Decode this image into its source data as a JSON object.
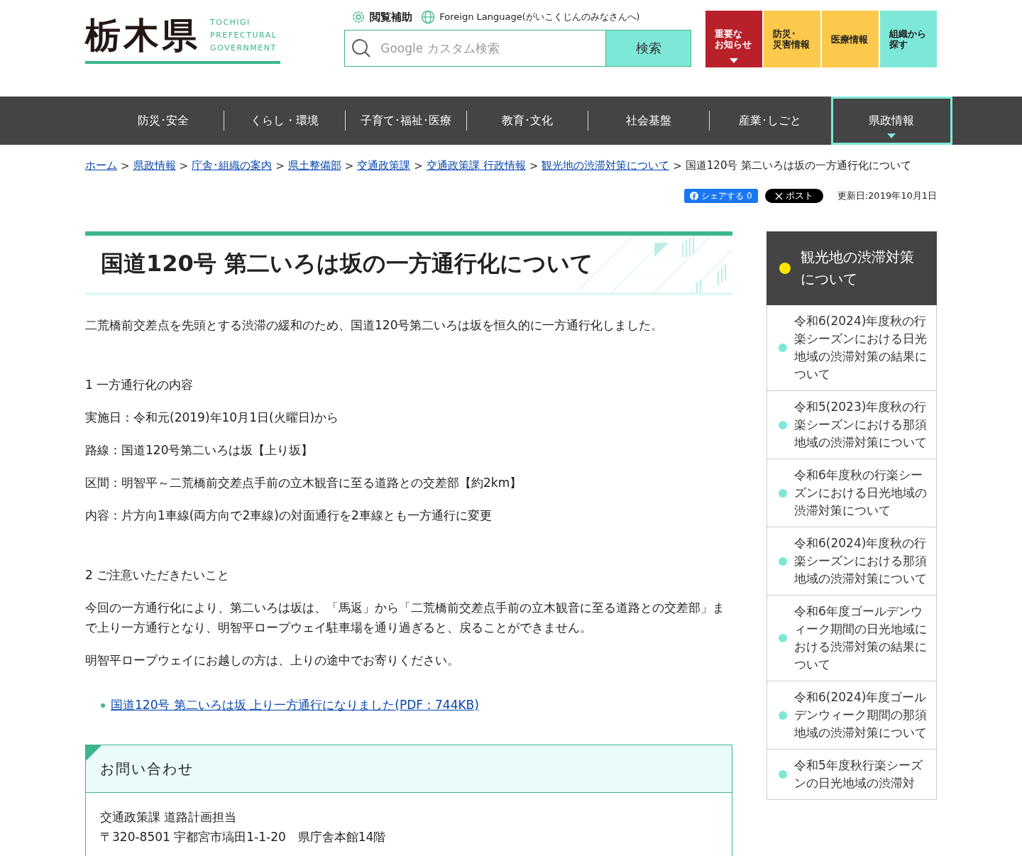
{
  "header": {
    "logo": {
      "kanji": "栃木県",
      "english": [
        "TOCHIGI",
        "PREFECTURAL",
        "GOVERNMENT"
      ]
    },
    "tools": [
      {
        "kind": "accessibility",
        "label": "閲覧補助"
      },
      {
        "kind": "language",
        "label": "Foreign Language",
        "note": "(がいこくじんのみなさんへ)"
      }
    ],
    "search": {
      "placeholder": "Google カスタム検索",
      "button": "検索"
    },
    "tiles": [
      {
        "lines": [
          "重要な",
          "お知らせ"
        ],
        "color": "#b9212a",
        "caret": true
      },
      {
        "lines": [
          "防災･",
          "災害情報"
        ],
        "color": "#fdc94c",
        "caret": false
      },
      {
        "lines": [
          "医療情報"
        ],
        "color": "#fdc94c",
        "caret": false
      },
      {
        "lines": [
          "組織から",
          "探す"
        ],
        "color": "#7ee8d8",
        "caret": false
      }
    ]
  },
  "nav": [
    {
      "label": "防災･安全",
      "selected": false
    },
    {
      "label": "くらし・環境",
      "selected": false
    },
    {
      "label": "子育て･福祉･医療",
      "selected": false
    },
    {
      "label": "教育･文化",
      "selected": false
    },
    {
      "label": "社会基盤",
      "selected": false
    },
    {
      "label": "産業･しごと",
      "selected": false
    },
    {
      "label": "県政情報",
      "selected": true
    }
  ],
  "breadcrumb": {
    "separator": ">",
    "links": [
      "ホーム",
      "県政情報",
      "庁舎･組織の案内",
      "県土整備部",
      "交通政策課",
      "交通政策課 行政情報",
      "観光地の渋滞対策について"
    ],
    "current": "国道120号 第二いろは坂の一方通行化について"
  },
  "share": {
    "facebook": "シェアする 0",
    "x": "ポスト",
    "updated": "更新日:2019年10月1日"
  },
  "article": {
    "title": "国道120号 第二いろは坂の一方通行化について",
    "blocks": [
      {
        "kind": "p",
        "text": "二荒橋前交差点を先頭とする渋滞の緩和のため、国道120号第二いろは坂を恒久的に一方通行化しました。"
      },
      {
        "kind": "gap"
      },
      {
        "kind": "p",
        "text": "1 一方通行化の内容"
      },
      {
        "kind": "p",
        "text": "実施日：令和元(2019)年10月1日(火曜日)から"
      },
      {
        "kind": "p",
        "text": "路線：国道120号第二いろは坂【上り坂】"
      },
      {
        "kind": "p",
        "text": "区間：明智平～二荒橋前交差点手前の立木観音に至る道路との交差部【約2km】"
      },
      {
        "kind": "p",
        "text": "内容：片方向1車線(両方向で2車線)の対面通行を2車線とも一方通行に変更"
      },
      {
        "kind": "gap"
      },
      {
        "kind": "p",
        "text": "2 ご注意いただきたいこと"
      },
      {
        "kind": "p",
        "text": "今回の一方通行化により、第二いろは坂は、「馬返」から「二荒橋前交差点手前の立木観音に至る道路との交差部」まで上り一方通行となり、明智平ロープウェイ駐車場を通り過ぎると、戻ることができません。"
      },
      {
        "kind": "p",
        "text": "明智平ロープウェイにお越しの方は、上りの途中でお寄りください。"
      },
      {
        "kind": "gap"
      },
      {
        "kind": "link",
        "text": "国道120号 第二いろは坂 上り一方通行になりました(PDF：744KB)"
      }
    ],
    "contact": {
      "title": "お問い合わせ",
      "lines": [
        "交通政策課 道路計画担当",
        "〒320-8501 宇都宮市塙田1-1-20　県庁舎本館14階"
      ]
    }
  },
  "sidebar": {
    "title": "観光地の渋滞対策について",
    "items": [
      "令和6(2024)年度秋の行楽シーズンにおける日光地域の渋滞対策の結果について",
      "令和5(2023)年度秋の行楽シーズンにおける那須地域の渋滞対策について",
      "令和6年度秋の行楽シーズンにおける日光地域の渋滞対策について",
      "令和6(2024)年度秋の行楽シーズンにおける那須地域の渋滞対策について",
      "令和6年度ゴールデンウィーク期間の日光地域における渋滞対策の結果について",
      "令和6(2024)年度ゴールデンウィーク期間の那須地域の渋滞対策について",
      "令和5年度秋行楽シーズンの日光地域の渋滞対"
    ]
  }
}
